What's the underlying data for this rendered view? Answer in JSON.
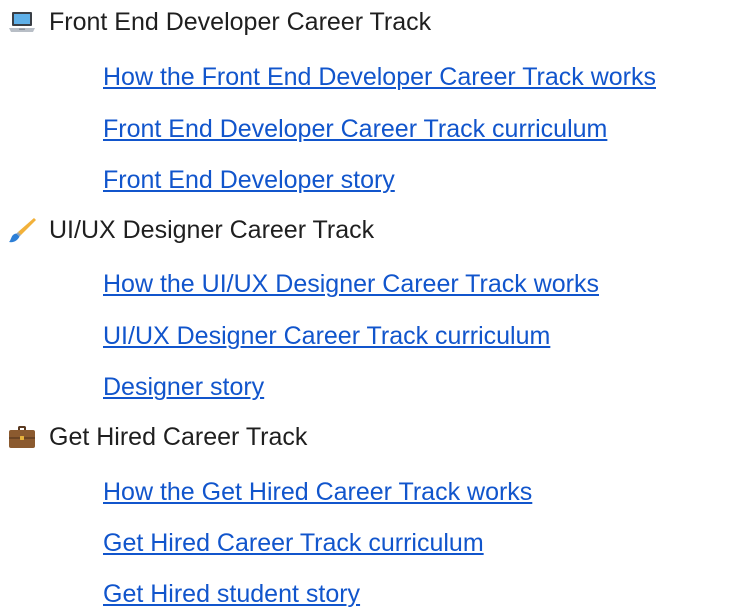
{
  "sections": [
    {
      "title": "Front End Developer Career Track",
      "icon": "laptop-icon",
      "links": [
        "How the Front End Developer Career Track works",
        "Front End Developer Career Track curriculum",
        "Front End Developer story"
      ]
    },
    {
      "title": "UI/UX Designer Career Track",
      "icon": "paintbrush-icon",
      "links": [
        "How the UI/UX Designer Career Track works",
        "UI/UX Designer Career Track curriculum",
        "Designer story"
      ]
    },
    {
      "title": "Get Hired Career Track",
      "icon": "briefcase-icon",
      "links": [
        "How the Get Hired Career Track works",
        "Get Hired Career Track curriculum",
        "Get Hired student story"
      ]
    }
  ],
  "colors": {
    "link": "#1155cc",
    "text": "#1f1f1f"
  }
}
